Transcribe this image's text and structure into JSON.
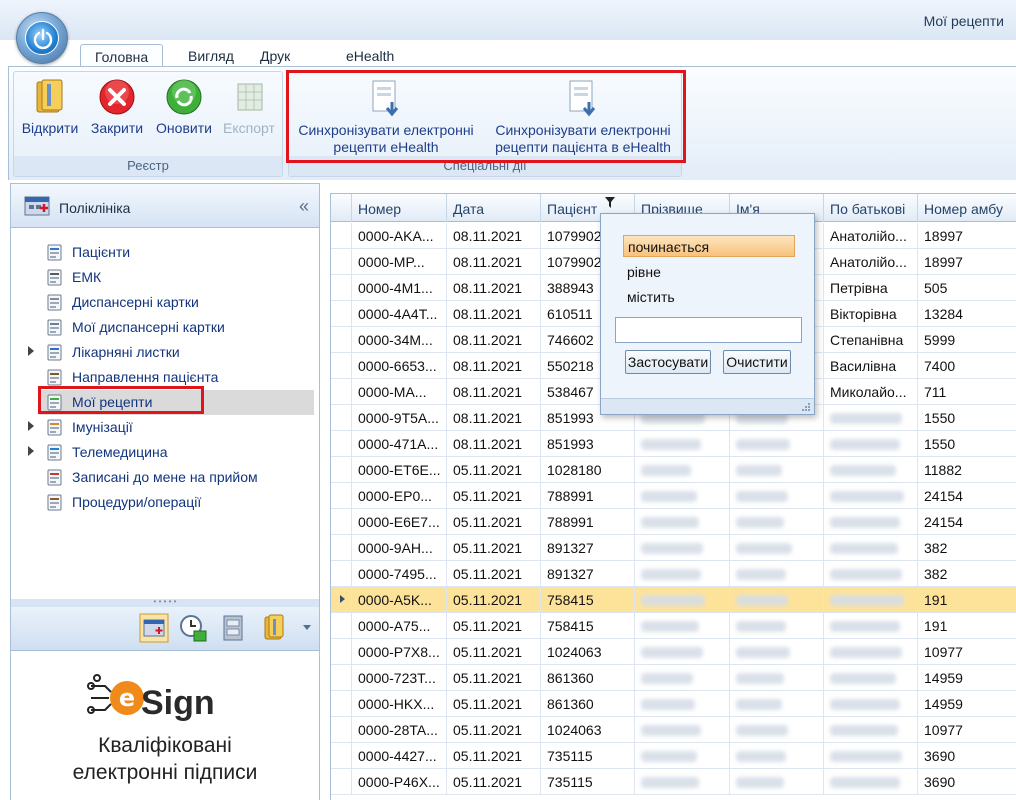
{
  "window": {
    "title": "Мої рецепти"
  },
  "tabs": [
    "Головна",
    "Вигляд",
    "Друк",
    "eHealth"
  ],
  "ribbon": {
    "registry": {
      "label": "Реєстр",
      "buttons": [
        {
          "label": "Відкрити",
          "icon": "folder-book-icon"
        },
        {
          "label": "Закрити",
          "icon": "close-red-icon"
        },
        {
          "label": "Оновити",
          "icon": "refresh-green-icon"
        },
        {
          "label": "Експорт",
          "icon": "export-grid-icon"
        }
      ]
    },
    "special": {
      "label": "Спеціальні дії",
      "buttons": [
        {
          "line1": "Синхронізувати електронні",
          "line2": "рецепти eHealth",
          "icon": "sync-document-icon"
        },
        {
          "line1": "Синхронізувати електронні",
          "line2": "рецепти пацієнта в eHealth",
          "icon": "sync-document-icon"
        }
      ]
    }
  },
  "nav": {
    "title": "Поліклініка",
    "collapse": "«",
    "items": [
      {
        "label": "Пацієнти",
        "icon": "patients-icon",
        "expandable": false
      },
      {
        "label": "ЕМК",
        "icon": "emk-icon",
        "expandable": false
      },
      {
        "label": "Диспансерні картки",
        "icon": "cards-icon",
        "expandable": false
      },
      {
        "label": "Мої диспансерні картки",
        "icon": "my-cards-icon",
        "expandable": false
      },
      {
        "label": "Лікарняні листки",
        "icon": "sick-leave-icon",
        "expandable": true
      },
      {
        "label": "Направлення пацієнта",
        "icon": "referral-icon",
        "expandable": false
      },
      {
        "label": "Мої рецепти",
        "icon": "prescription-icon",
        "expandable": false
      },
      {
        "label": "Імунізації",
        "icon": "immunization-icon",
        "expandable": true
      },
      {
        "label": "Телемедицина",
        "icon": "telemedicine-icon",
        "expandable": true
      },
      {
        "label": "Записані до мене на прийом",
        "icon": "appointment-icon",
        "expandable": false
      },
      {
        "label": "Процедури/операції",
        "icon": "procedures-icon",
        "expandable": false
      }
    ],
    "selected_index": 6
  },
  "promo": {
    "brand": "Sign",
    "line1": "Кваліфіковані",
    "line2": "електронні підписи"
  },
  "grid": {
    "columns": [
      "Номер",
      "Дата",
      "Пацієнт",
      "Прізвище",
      "Ім'я",
      "По батькові",
      "Номер амбу"
    ],
    "rows": [
      {
        "num": "0000-AKA...",
        "date": "08.11.2021",
        "pat": "1079902",
        "patr": "Анатолійо...",
        "amb": "18997"
      },
      {
        "num": "0000-MP...",
        "date": "08.11.2021",
        "pat": "1079902",
        "patr": "Анатолійо...",
        "amb": "18997"
      },
      {
        "num": "0000-4M1...",
        "date": "08.11.2021",
        "pat": "388943",
        "patr": "Петрівна",
        "amb": "505"
      },
      {
        "num": "0000-4A4T...",
        "date": "08.11.2021",
        "pat": "610511",
        "patr": "Вікторівна",
        "amb": "13284"
      },
      {
        "num": "0000-34M...",
        "date": "08.11.2021",
        "pat": "746602",
        "patr": "Степанівна",
        "amb": "5999"
      },
      {
        "num": "0000-6653...",
        "date": "08.11.2021",
        "pat": "550218",
        "patr": "Василівна",
        "amb": "7400"
      },
      {
        "num": "0000-MA...",
        "date": "08.11.2021",
        "pat": "538467",
        "patr": "Миколайо...",
        "amb": "711"
      },
      {
        "num": "0000-9T5A...",
        "date": "08.11.2021",
        "pat": "851993",
        "patr": "",
        "amb": "1550"
      },
      {
        "num": "0000-471A...",
        "date": "08.11.2021",
        "pat": "851993",
        "patr": "",
        "amb": "1550"
      },
      {
        "num": "0000-ET6E...",
        "date": "05.11.2021",
        "pat": "1028180",
        "patr": "",
        "amb": "11882"
      },
      {
        "num": "0000-EP0...",
        "date": "05.11.2021",
        "pat": "788991",
        "patr": "",
        "amb": "24154"
      },
      {
        "num": "0000-E6E7...",
        "date": "05.11.2021",
        "pat": "788991",
        "patr": "",
        "amb": "24154"
      },
      {
        "num": "0000-9AH...",
        "date": "05.11.2021",
        "pat": "891327",
        "patr": "",
        "amb": "382"
      },
      {
        "num": "0000-7495...",
        "date": "05.11.2021",
        "pat": "891327",
        "patr": "",
        "amb": "382"
      },
      {
        "num": "0000-A5K...",
        "date": "05.11.2021",
        "pat": "758415",
        "patr": "",
        "amb": "191"
      },
      {
        "num": "0000-A75...",
        "date": "05.11.2021",
        "pat": "758415",
        "patr": "",
        "amb": "191"
      },
      {
        "num": "0000-P7X8...",
        "date": "05.11.2021",
        "pat": "1024063",
        "patr": "",
        "amb": "10977"
      },
      {
        "num": "0000-723T...",
        "date": "05.11.2021",
        "pat": "861360",
        "patr": "",
        "amb": "14959"
      },
      {
        "num": "0000-HKX...",
        "date": "05.11.2021",
        "pat": "861360",
        "patr": "",
        "amb": "14959"
      },
      {
        "num": "0000-28TA...",
        "date": "05.11.2021",
        "pat": "1024063",
        "patr": "",
        "amb": "10977"
      },
      {
        "num": "0000-4427...",
        "date": "05.11.2021",
        "pat": "735115",
        "patr": "",
        "amb": "3690"
      },
      {
        "num": "0000-P46X...",
        "date": "05.11.2021",
        "pat": "735115",
        "patr": "",
        "amb": "3690"
      }
    ],
    "selected_row": 14
  },
  "filter": {
    "options": [
      "починається",
      "рівне",
      "містить"
    ],
    "highlighted": 0,
    "value": "",
    "apply": "Застосувати",
    "clear": "Очистити"
  },
  "colors": {
    "accent": "#1f3e8a",
    "selection": "#fde39a",
    "highlight_box": "#e0141b"
  }
}
